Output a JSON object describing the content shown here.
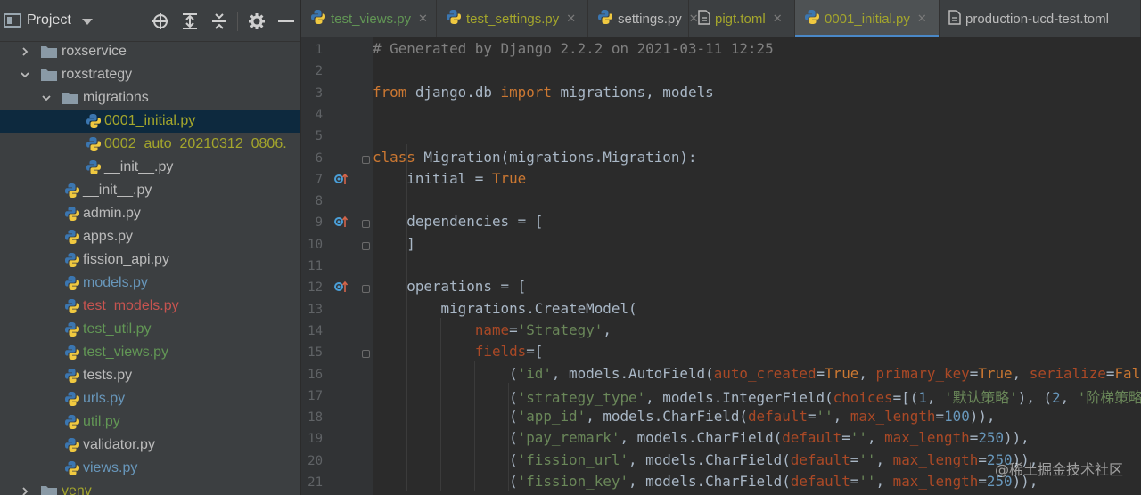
{
  "sidebar": {
    "title": "Project",
    "tree": [
      {
        "label": "roxservice",
        "type": "folder",
        "color": "#bbbbbb",
        "expanded": false
      },
      {
        "label": "roxstrategy",
        "type": "folder",
        "color": "#bbbbbb",
        "expanded": true
      },
      {
        "label": "migrations",
        "type": "folder",
        "color": "#bbbbbb",
        "expanded": true
      },
      {
        "label": "0001_initial.py",
        "type": "file",
        "color": "#a4a62c",
        "selected": true
      },
      {
        "label": "0002_auto_20210312_0806.",
        "type": "file",
        "color": "#a4a62c"
      },
      {
        "label": "__init__.py",
        "type": "file",
        "color": "#bbbbbb"
      },
      {
        "label": "__init__.py",
        "type": "file",
        "color": "#bbbbbb"
      },
      {
        "label": "admin.py",
        "type": "file",
        "color": "#bbbbbb"
      },
      {
        "label": "apps.py",
        "type": "file",
        "color": "#bbbbbb"
      },
      {
        "label": "fission_api.py",
        "type": "file",
        "color": "#bbbbbb"
      },
      {
        "label": "models.py",
        "type": "file",
        "color": "#6897bb"
      },
      {
        "label": "test_models.py",
        "type": "file",
        "color": "#c75450"
      },
      {
        "label": "test_util.py",
        "type": "file",
        "color": "#629755"
      },
      {
        "label": "test_views.py",
        "type": "file",
        "color": "#629755"
      },
      {
        "label": "tests.py",
        "type": "file",
        "color": "#bbbbbb"
      },
      {
        "label": "urls.py",
        "type": "file",
        "color": "#6897bb"
      },
      {
        "label": "util.py",
        "type": "file",
        "color": "#629755"
      },
      {
        "label": "validator.py",
        "type": "file",
        "color": "#bbbbbb"
      },
      {
        "label": "views.py",
        "type": "file",
        "color": "#6897bb"
      },
      {
        "label": "venv",
        "type": "folder",
        "color": "#a4a62c",
        "expanded": false
      }
    ]
  },
  "tabs": [
    {
      "label": "test_views.py",
      "color": "#629755",
      "icon": "python-file-icon",
      "closable": true
    },
    {
      "label": "test_settings.py",
      "color": "#a4a62c",
      "icon": "python-file-icon",
      "closable": true
    },
    {
      "label": "settings.py",
      "color": "#bbbbbb",
      "icon": "python-file-icon",
      "closable": true
    },
    {
      "label": "pigt.toml",
      "color": "#a4a62c",
      "icon": "toml-file-icon",
      "closable": true
    },
    {
      "label": "0001_initial.py",
      "color": "#a4a62c",
      "icon": "python-file-icon",
      "active": true,
      "closable": true
    },
    {
      "label": "production-ucd-test.toml",
      "color": "#bbbbbb",
      "icon": "toml-file-icon"
    }
  ],
  "code": {
    "line_numbers": [
      "1",
      "2",
      "3",
      "4",
      "5",
      "6",
      "7",
      "8",
      "9",
      "10",
      "11",
      "12",
      "13",
      "14",
      "15",
      "16",
      "17",
      "18",
      "19",
      "20",
      "21"
    ],
    "lines": [
      [
        {
          "t": "# Generated by Django 2.2.2 on 2021-03-11 12:25",
          "c": "cm"
        }
      ],
      [],
      [
        {
          "t": "from",
          "c": "kw"
        },
        {
          "t": " django.db "
        },
        {
          "t": "import",
          "c": "kw"
        },
        {
          "t": " migrations, models"
        }
      ],
      [],
      [],
      [
        {
          "t": "class",
          "c": "kw"
        },
        {
          "t": " Migration(migrations.Migration):"
        }
      ],
      [
        {
          "t": "    initial = "
        },
        {
          "t": "True",
          "c": "kw"
        }
      ],
      [],
      [
        {
          "t": "    dependencies = ["
        }
      ],
      [
        {
          "t": "    ]"
        }
      ],
      [],
      [
        {
          "t": "    operations = ["
        }
      ],
      [
        {
          "t": "        migrations.CreateModel("
        }
      ],
      [
        {
          "t": "            "
        },
        {
          "t": "name",
          "c": "kwarg"
        },
        {
          "t": "="
        },
        {
          "t": "'Strategy'",
          "c": "st"
        },
        {
          "t": ","
        }
      ],
      [
        {
          "t": "            "
        },
        {
          "t": "fields",
          "c": "kwarg"
        },
        {
          "t": "=["
        }
      ],
      [
        {
          "t": "                ("
        },
        {
          "t": "'id'",
          "c": "st"
        },
        {
          "t": ", models.AutoField("
        },
        {
          "t": "auto_created",
          "c": "kwarg"
        },
        {
          "t": "="
        },
        {
          "t": "True",
          "c": "kw"
        },
        {
          "t": ", "
        },
        {
          "t": "primary_key",
          "c": "kwarg"
        },
        {
          "t": "="
        },
        {
          "t": "True",
          "c": "kw"
        },
        {
          "t": ", "
        },
        {
          "t": "serialize",
          "c": "kwarg"
        },
        {
          "t": "="
        },
        {
          "t": "Fal",
          "c": "kw"
        }
      ],
      [
        {
          "t": "                ("
        },
        {
          "t": "'strategy_type'",
          "c": "st"
        },
        {
          "t": ", models.IntegerField("
        },
        {
          "t": "choices",
          "c": "kwarg"
        },
        {
          "t": "=[("
        },
        {
          "t": "1",
          "c": "nm"
        },
        {
          "t": ", "
        },
        {
          "t": "'默认策略'",
          "c": "st"
        },
        {
          "t": "), ("
        },
        {
          "t": "2",
          "c": "nm"
        },
        {
          "t": ", "
        },
        {
          "t": "'阶梯策略",
          "c": "st"
        }
      ],
      [
        {
          "t": "                ("
        },
        {
          "t": "'app_id'",
          "c": "st"
        },
        {
          "t": ", models.CharField("
        },
        {
          "t": "default",
          "c": "kwarg"
        },
        {
          "t": "="
        },
        {
          "t": "''",
          "c": "st"
        },
        {
          "t": ", "
        },
        {
          "t": "max_length",
          "c": "kwarg"
        },
        {
          "t": "="
        },
        {
          "t": "100",
          "c": "nm"
        },
        {
          "t": ")),"
        }
      ],
      [
        {
          "t": "                ("
        },
        {
          "t": "'pay_remark'",
          "c": "st"
        },
        {
          "t": ", models.CharField("
        },
        {
          "t": "default",
          "c": "kwarg"
        },
        {
          "t": "="
        },
        {
          "t": "''",
          "c": "st"
        },
        {
          "t": ", "
        },
        {
          "t": "max_length",
          "c": "kwarg"
        },
        {
          "t": "="
        },
        {
          "t": "250",
          "c": "nm"
        },
        {
          "t": ")),"
        }
      ],
      [
        {
          "t": "                ("
        },
        {
          "t": "'fission_url'",
          "c": "st"
        },
        {
          "t": ", models.CharField("
        },
        {
          "t": "default",
          "c": "kwarg"
        },
        {
          "t": "="
        },
        {
          "t": "''",
          "c": "st"
        },
        {
          "t": ", "
        },
        {
          "t": "max_length",
          "c": "kwarg"
        },
        {
          "t": "="
        },
        {
          "t": "250",
          "c": "nm"
        },
        {
          "t": ")),"
        }
      ],
      [
        {
          "t": "                ("
        },
        {
          "t": "'fission_key'",
          "c": "st"
        },
        {
          "t": ", models.CharField("
        },
        {
          "t": "default",
          "c": "kwarg"
        },
        {
          "t": "="
        },
        {
          "t": "''",
          "c": "st"
        },
        {
          "t": ", "
        },
        {
          "t": "max_length",
          "c": "kwarg"
        },
        {
          "t": "="
        },
        {
          "t": "250",
          "c": "nm"
        },
        {
          "t": ")),"
        }
      ]
    ]
  },
  "watermark": "@稀土掘金技术社区"
}
